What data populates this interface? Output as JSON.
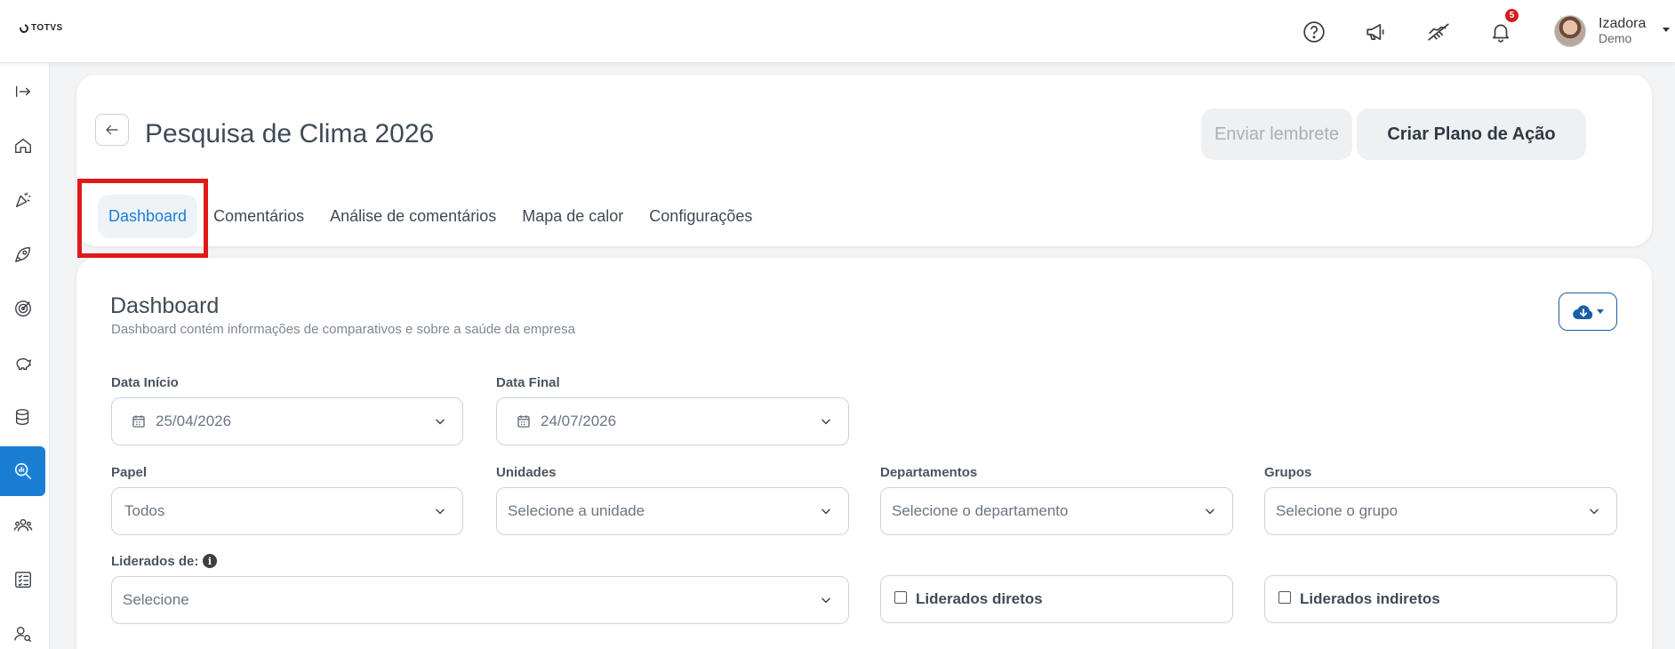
{
  "topbar": {
    "logo_text": "TOTVS",
    "notification_count": "5",
    "user": {
      "name": "Izadora",
      "subtitle": "Demo"
    }
  },
  "header": {
    "title": "Pesquisa de Clima 2026",
    "send_reminder_label": "Enviar lembrete",
    "create_plan_label": "Criar Plano de Ação",
    "tabs": [
      {
        "label": "Dashboard",
        "active": true
      },
      {
        "label": "Comentários"
      },
      {
        "label": "Análise de comentários"
      },
      {
        "label": "Mapa de calor"
      },
      {
        "label": "Configurações"
      }
    ]
  },
  "dashboard": {
    "title": "Dashboard",
    "subtitle": "Dashboard contém informações de comparativos e sobre a saúde da empresa",
    "filters": {
      "start_date": {
        "label": "Data Início",
        "value": "25/04/2026"
      },
      "end_date": {
        "label": "Data Final",
        "value": "24/07/2026"
      },
      "role": {
        "label": "Papel",
        "value": "Todos"
      },
      "units": {
        "label": "Unidades",
        "placeholder": "Selecione a unidade"
      },
      "departments": {
        "label": "Departamentos",
        "placeholder": "Selecione o departamento"
      },
      "groups": {
        "label": "Grupos",
        "placeholder": "Selecione o grupo"
      },
      "led_by": {
        "label": "Liderados de:",
        "placeholder": "Selecione"
      },
      "direct_reports": {
        "label": "Liderados diretos",
        "checked": false
      },
      "indirect_reports": {
        "label": "Liderados indiretos",
        "checked": false
      }
    }
  },
  "colors": {
    "accent": "#1a7fd4",
    "highlight": "#e01919",
    "badge": "#d01f1f"
  }
}
